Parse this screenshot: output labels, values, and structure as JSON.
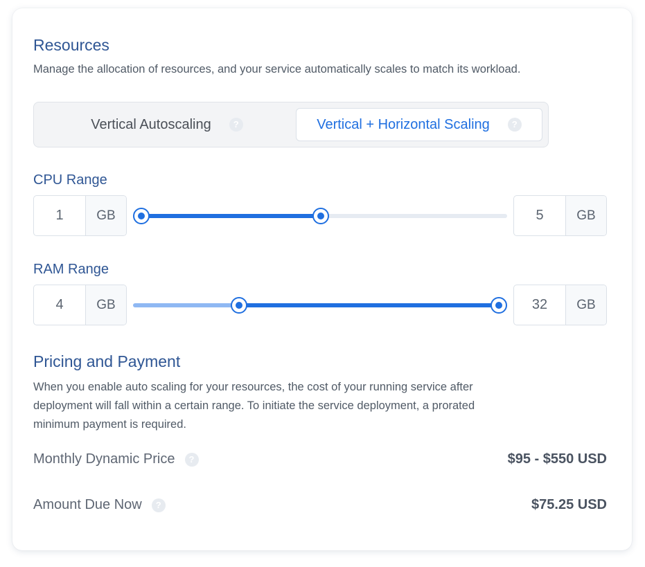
{
  "resources": {
    "title": "Resources",
    "description": "Manage the allocation of resources, and your service automatically scales to match its workload."
  },
  "scaling_toggle": {
    "options": [
      {
        "label": "Vertical Autoscaling",
        "selected": false
      },
      {
        "label": "Vertical + Horizontal Scaling",
        "selected": true
      }
    ],
    "help_glyph": "?"
  },
  "cpu": {
    "label": "CPU Range",
    "min_value": "1",
    "min_unit": "GB",
    "max_value": "5",
    "max_unit": "GB",
    "range_low_fraction": 0.0,
    "range_high_fraction": 0.49
  },
  "ram": {
    "label": "RAM Range",
    "min_value": "4",
    "min_unit": "GB",
    "max_value": "32",
    "max_unit": "GB",
    "range_low_fraction": 0.29,
    "range_high_fraction": 1.0
  },
  "pricing": {
    "title": "Pricing and Payment",
    "description": [
      "When you enable auto scaling for your resources, the cost of your running service after",
      "deployment will fall within a certain range. To initiate the service deployment, a prorated",
      "minimum payment is required."
    ],
    "monthly_label": "Monthly Dynamic Price",
    "monthly_value": "$95 - $550 USD",
    "due_label": "Amount Due Now",
    "due_value": "$75.25 USD"
  },
  "colors": {
    "accent": "#1f6fe0",
    "heading": "#2f5694",
    "track_inactive": "#e6ebf2",
    "track_light": "#8fb8f3"
  }
}
